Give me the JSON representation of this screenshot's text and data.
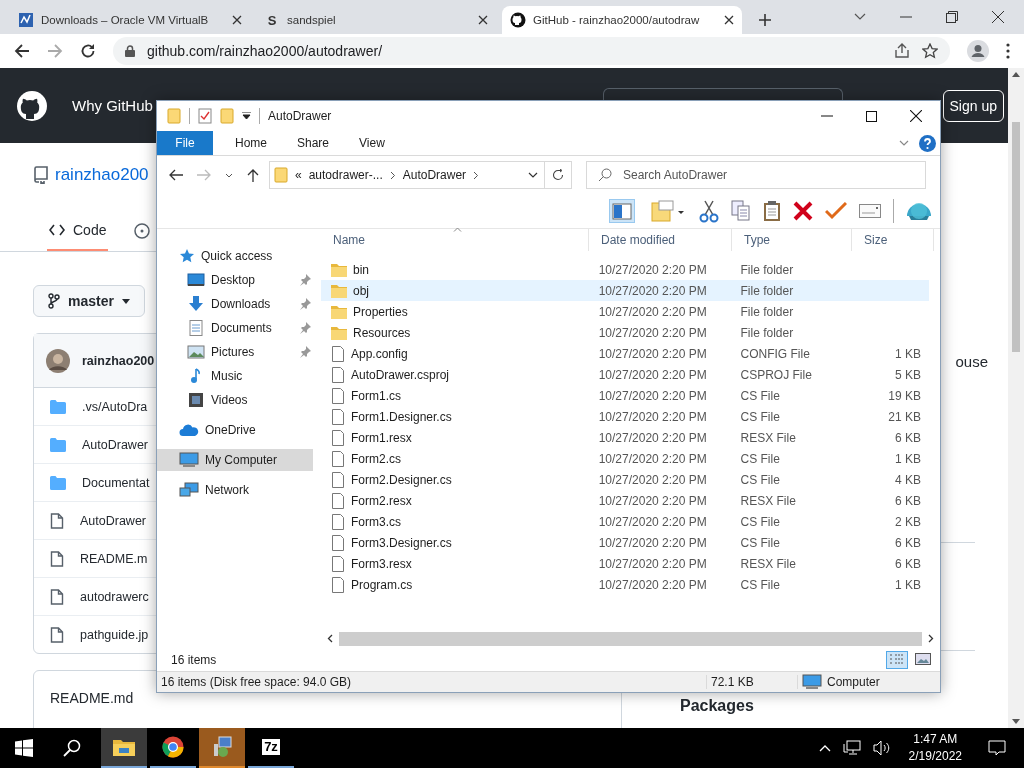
{
  "browser": {
    "tabs": [
      {
        "kind": "vbox",
        "title": "Downloads – Oracle VM VirtualB",
        "selected": false
      },
      {
        "kind": "letter",
        "favicon_text": "S",
        "title": "sandspiel",
        "selected": false
      },
      {
        "kind": "github",
        "title": "GitHub - rainzhao2000/autodraw",
        "selected": true
      }
    ],
    "url": "github.com/rainzhao2000/autodrawer/"
  },
  "github": {
    "nav": "Why GitHub",
    "signup": "Sign up",
    "owner": "rainzhao200",
    "tabs": [
      {
        "label": "Code",
        "selected": true
      }
    ],
    "branch": "master",
    "commit_author": "rainzhao200",
    "files": [
      {
        "kind": "folder",
        "name": ".vs/AutoDra"
      },
      {
        "kind": "folder",
        "name": "AutoDrawer"
      },
      {
        "kind": "folder",
        "name": "Documentat"
      },
      {
        "kind": "file",
        "name": "AutoDrawer"
      },
      {
        "kind": "file",
        "name": "README.m"
      },
      {
        "kind": "file",
        "name": "autodrawerc"
      },
      {
        "kind": "file",
        "name": "pathguide.jp"
      }
    ],
    "readme_title": "README.md",
    "about_fragment": "ouse",
    "packages_title": "Packages"
  },
  "explorer": {
    "title": "AutoDrawer",
    "ribbon_tabs": [
      {
        "kind": "menu",
        "label": "File"
      },
      {
        "kind": "tab",
        "label": "Home"
      },
      {
        "kind": "tab",
        "label": "Share"
      },
      {
        "kind": "tab",
        "label": "View"
      }
    ],
    "address": [
      "«",
      "autodrawer-...",
      "AutoDrawer"
    ],
    "search": {
      "placeholder": "Search AutoDrawer"
    },
    "nav": [
      {
        "kind": "quick",
        "label": "Quick access",
        "selected": false,
        "children": [
          {
            "kind": "desktop",
            "label": "Desktop",
            "pinned": true,
            "selected": false
          },
          {
            "kind": "downloads",
            "label": "Downloads",
            "pinned": true,
            "selected": false
          },
          {
            "kind": "documents",
            "label": "Documents",
            "pinned": true,
            "selected": false
          },
          {
            "kind": "pictures",
            "label": "Pictures",
            "pinned": true,
            "selected": false
          },
          {
            "kind": "music",
            "label": "Music",
            "pinned": false,
            "selected": false
          },
          {
            "kind": "videos",
            "label": "Videos",
            "pinned": false,
            "selected": false
          }
        ]
      },
      {
        "kind": "onedrive",
        "label": "OneDrive",
        "selected": false
      },
      {
        "kind": "computer",
        "label": "My Computer",
        "selected": true
      },
      {
        "kind": "network",
        "label": "Network",
        "selected": false
      }
    ],
    "columns": [
      "Name",
      "Date modified",
      "Type",
      "Size"
    ],
    "rows": [
      {
        "kind": "folder",
        "name": "bin",
        "date": "10/27/2020 2:20 PM",
        "type": "File folder",
        "selected": false
      },
      {
        "kind": "folder",
        "name": "obj",
        "date": "10/27/2020 2:20 PM",
        "type": "File folder",
        "selected": true
      },
      {
        "kind": "folder",
        "name": "Properties",
        "date": "10/27/2020 2:20 PM",
        "type": "File folder",
        "selected": false
      },
      {
        "kind": "folder",
        "name": "Resources",
        "date": "10/27/2020 2:20 PM",
        "type": "File folder",
        "selected": false
      },
      {
        "kind": "file",
        "name": "App.config",
        "date": "10/27/2020 2:20 PM",
        "type": "CONFIG File",
        "size": "1 KB",
        "selected": false
      },
      {
        "kind": "file",
        "name": "AutoDrawer.csproj",
        "date": "10/27/2020 2:20 PM",
        "type": "CSPROJ File",
        "size": "5 KB",
        "selected": false
      },
      {
        "kind": "file",
        "name": "Form1.cs",
        "date": "10/27/2020 2:20 PM",
        "type": "CS File",
        "size": "19 KB",
        "selected": false
      },
      {
        "kind": "file",
        "name": "Form1.Designer.cs",
        "date": "10/27/2020 2:20 PM",
        "type": "CS File",
        "size": "21 KB",
        "selected": false
      },
      {
        "kind": "file",
        "name": "Form1.resx",
        "date": "10/27/2020 2:20 PM",
        "type": "RESX File",
        "size": "6 KB",
        "selected": false
      },
      {
        "kind": "file",
        "name": "Form2.cs",
        "date": "10/27/2020 2:20 PM",
        "type": "CS File",
        "size": "1 KB",
        "selected": false
      },
      {
        "kind": "file",
        "name": "Form2.Designer.cs",
        "date": "10/27/2020 2:20 PM",
        "type": "CS File",
        "size": "4 KB",
        "selected": false
      },
      {
        "kind": "file",
        "name": "Form2.resx",
        "date": "10/27/2020 2:20 PM",
        "type": "RESX File",
        "size": "6 KB",
        "selected": false
      },
      {
        "kind": "file",
        "name": "Form3.cs",
        "date": "10/27/2020 2:20 PM",
        "type": "CS File",
        "size": "2 KB",
        "selected": false
      },
      {
        "kind": "file",
        "name": "Form3.Designer.cs",
        "date": "10/27/2020 2:20 PM",
        "type": "CS File",
        "size": "6 KB",
        "selected": false
      },
      {
        "kind": "file",
        "name": "Form3.resx",
        "date": "10/27/2020 2:20 PM",
        "type": "RESX File",
        "size": "6 KB",
        "selected": false
      },
      {
        "kind": "file",
        "name": "Program.cs",
        "date": "10/27/2020 2:20 PM",
        "type": "CS File",
        "size": "1 KB",
        "selected": false
      }
    ],
    "item_count": "16 items",
    "views": [
      {
        "kind": "details",
        "selected": true
      },
      {
        "kind": "preview",
        "selected": false
      }
    ],
    "status": {
      "summary": "16 items (Disk free space: 94.0 GB)",
      "size": "72.1 KB",
      "location": "Computer"
    }
  },
  "taskbar": {
    "apps": [
      {
        "kind": "explorer",
        "active": true,
        "attention": false
      },
      {
        "kind": "chrome",
        "active": false,
        "attention": false
      },
      {
        "kind": "installer",
        "active": false,
        "attention": true
      },
      {
        "kind": "sevenzip",
        "label": "7z",
        "active": false,
        "attention": false
      }
    ],
    "time": "1:47 AM",
    "date": "2/19/2022"
  }
}
